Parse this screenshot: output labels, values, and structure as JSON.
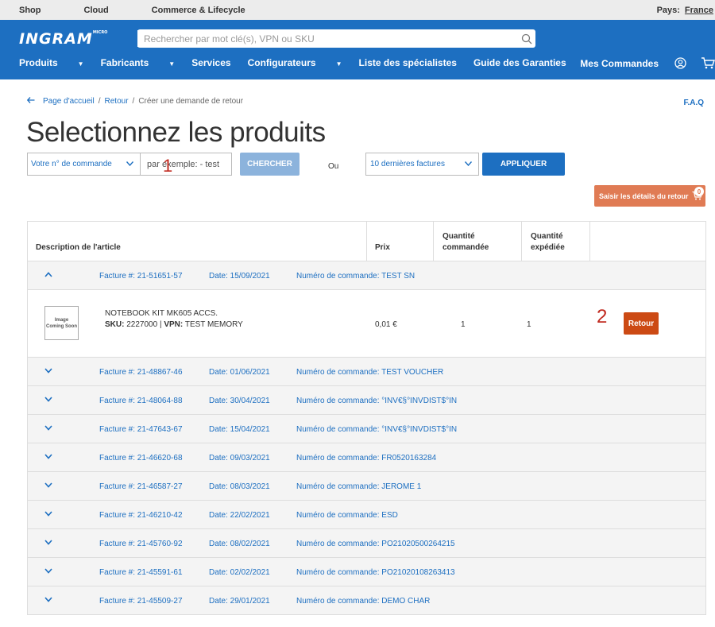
{
  "topbar": {
    "links": [
      "Shop",
      "Cloud",
      "Commerce & Lifecycle"
    ],
    "country_label": "Pays:",
    "country_value": "France"
  },
  "header": {
    "logo": "INGRAM",
    "logo_small": "MICRO",
    "search_placeholder": "Rechercher par mot clé(s), VPN ou SKU",
    "nav": [
      "Produits",
      "Fabricants",
      "Services",
      "Configurateurs",
      "Liste des spécialistes",
      "Guide des Garanties"
    ],
    "my_orders": "Mes Commandes"
  },
  "breadcrumb": {
    "items": [
      "Page d'accueil",
      "Retour",
      "Créer une demande de retour"
    ],
    "sep": "/"
  },
  "faq": "F.A.Q",
  "page_title": "Selectionnez les produits",
  "filters": {
    "order_select": "Votre n° de commande",
    "order_input_placeholder": "par exemple: - test",
    "search_button": "CHERCHER",
    "or_label": "Ou",
    "invoices_select": "10 dernières factures",
    "apply_button": "APPLIQUER"
  },
  "return_details": {
    "label": "Saisir les détails du retour",
    "count": "0"
  },
  "annotations": [
    "1",
    "2"
  ],
  "table": {
    "headers": {
      "description": "Description de l'article",
      "price": "Prix",
      "qty_ordered_1": "Quantité",
      "qty_ordered_2": "commandée",
      "qty_shipped_1": "Quantité",
      "qty_shipped_2": "expédiée"
    },
    "first_invoice": {
      "invoice": "Facture #: 21-51651-57",
      "date": "Date: 15/09/2021",
      "order": "Numéro de commande: TEST SN"
    },
    "product": {
      "thumb": "Image Coming Soon",
      "name": "NOTEBOOK KIT MK605 ACCS.",
      "sku_label": "SKU:",
      "sku_value": "2227000 | ",
      "vpn_label": "VPN:",
      "vpn_value": "TEST MEMORY",
      "price": "0,01 €",
      "qty_ordered": "1",
      "qty_shipped": "1",
      "return_button": "Retour"
    },
    "invoices": [
      {
        "invoice": "Facture #: 21-48867-46",
        "date": "Date: 01/06/2021",
        "order": "Numéro de commande: TEST VOUCHER"
      },
      {
        "invoice": "Facture #: 21-48064-88",
        "date": "Date: 30/04/2021",
        "order": "Numéro de commande: °INV€§°INVDIST$°IN"
      },
      {
        "invoice": "Facture #: 21-47643-67",
        "date": "Date: 15/04/2021",
        "order": "Numéro de commande: °INV€§°INVDIST$°IN"
      },
      {
        "invoice": "Facture #: 21-46620-68",
        "date": "Date: 09/03/2021",
        "order": "Numéro de commande: FR0520163284"
      },
      {
        "invoice": "Facture #: 21-46587-27",
        "date": "Date: 08/03/2021",
        "order": "Numéro de commande: JEROME 1"
      },
      {
        "invoice": "Facture #: 21-46210-42",
        "date": "Date: 22/02/2021",
        "order": "Numéro de commande: ESD"
      },
      {
        "invoice": "Facture #: 21-45760-92",
        "date": "Date: 08/02/2021",
        "order": "Numéro de commande: PO21020500264215"
      },
      {
        "invoice": "Facture #: 21-45591-61",
        "date": "Date: 02/02/2021",
        "order": "Numéro de commande: PO21020108263413"
      },
      {
        "invoice": "Facture #: 21-45509-27",
        "date": "Date: 29/01/2021",
        "order": "Numéro de commande: DEMO CHAR"
      }
    ]
  },
  "colors": {
    "primary": "#1d6fc1",
    "accent": "#e07b54",
    "return": "#cc4a14",
    "annotation": "#c0281e"
  },
  "icons": [
    "search-icon",
    "user-icon",
    "cart-icon",
    "arrow-left-icon",
    "chevron-down-icon",
    "chevron-up-icon"
  ]
}
